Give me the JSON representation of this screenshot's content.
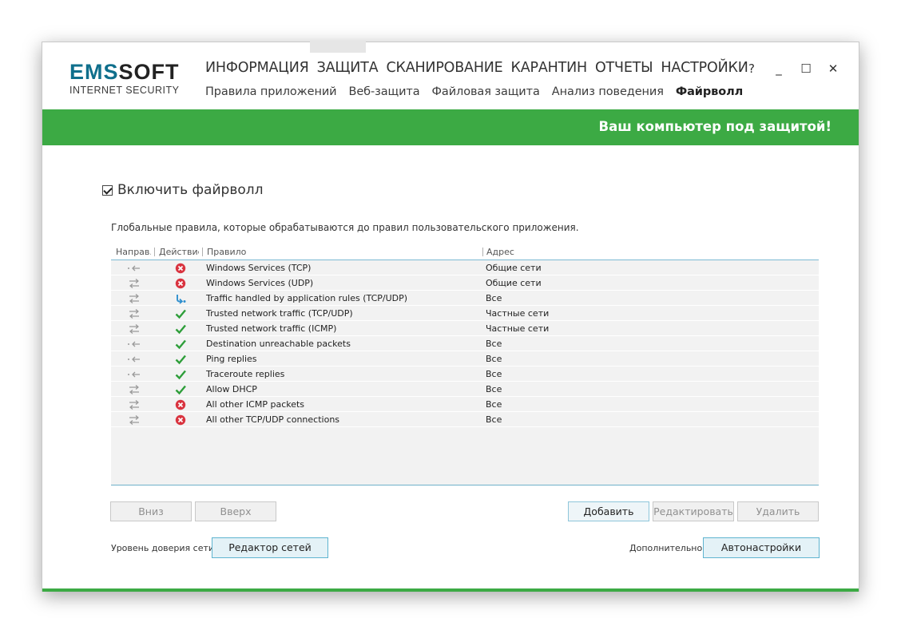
{
  "app": {
    "logo_main_left": "EMS",
    "logo_main_right": "SOFT",
    "logo_sub": "INTERNET SECURITY"
  },
  "main_nav": [
    "ИНФОРМАЦИЯ",
    "ЗАЩИТА",
    "СКАНИРОВАНИЕ",
    "КАРАНТИН",
    "ОТЧЕТЫ",
    "НАСТРОЙКИ"
  ],
  "sub_nav": [
    {
      "label": "Правила приложений",
      "active": false
    },
    {
      "label": "Веб-защита",
      "active": false
    },
    {
      "label": "Файловая защита",
      "active": false
    },
    {
      "label": "Анализ поведения",
      "active": false
    },
    {
      "label": "Файрволл",
      "active": true
    }
  ],
  "window_controls": {
    "help": "?",
    "minimize": "_",
    "maximize": "☐",
    "close": "✕"
  },
  "banner": {
    "text": "Ваш компьютер под защитой!",
    "color": "#3caa44"
  },
  "firewall": {
    "enable_label": "Включить файрволл",
    "enabled": true,
    "description": "Глобальные правила, которые обрабатываются до правил пользовательского приложения."
  },
  "table": {
    "headers": {
      "direction": "Направ.",
      "action": "Действие",
      "rule": "Правило",
      "address": "Адрес"
    },
    "rows": [
      {
        "dir": "in",
        "action": "block",
        "rule": "Windows Services (TCP)",
        "address": "Общие сети"
      },
      {
        "dir": "both",
        "action": "block",
        "rule": "Windows Services (UDP)",
        "address": "Общие сети"
      },
      {
        "dir": "both",
        "action": "app",
        "rule": "Traffic handled by application rules (TCP/UDP)",
        "address": "Все"
      },
      {
        "dir": "both",
        "action": "allow",
        "rule": "Trusted network traffic (TCP/UDP)",
        "address": "Частные сети"
      },
      {
        "dir": "both",
        "action": "allow",
        "rule": "Trusted network traffic (ICMP)",
        "address": "Частные сети"
      },
      {
        "dir": "in",
        "action": "allow",
        "rule": "Destination unreachable packets",
        "address": "Все"
      },
      {
        "dir": "in",
        "action": "allow",
        "rule": "Ping replies",
        "address": "Все"
      },
      {
        "dir": "in",
        "action": "allow",
        "rule": "Traceroute replies",
        "address": "Все"
      },
      {
        "dir": "both",
        "action": "allow",
        "rule": "Allow DHCP",
        "address": "Все"
      },
      {
        "dir": "both",
        "action": "block",
        "rule": "All other ICMP packets",
        "address": "Все"
      },
      {
        "dir": "both",
        "action": "block",
        "rule": "All other TCP/UDP connections",
        "address": "Все"
      }
    ]
  },
  "buttons": {
    "down": "Вниз",
    "up": "Вверх",
    "add": "Добавить",
    "edit": "Редактировать",
    "delete": "Удалить",
    "network_editor": "Редактор сетей",
    "autosettings": "Автонастройки"
  },
  "labels": {
    "trust_level": "Уровень доверия сети:",
    "additional": "Дополнительно:"
  },
  "colors": {
    "accent_green": "#3caa44",
    "logo_teal": "#0f6f8c",
    "block_red": "#d9333f",
    "allow_green": "#2e9e3a",
    "app_blue": "#2f8fce"
  }
}
